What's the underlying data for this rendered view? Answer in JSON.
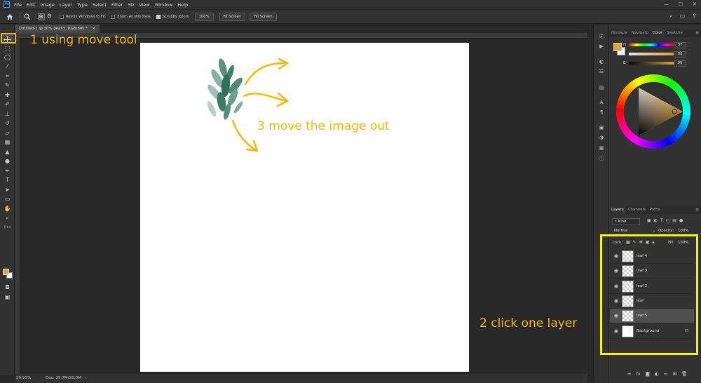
{
  "app": {
    "logo": "Ps"
  },
  "menubar": {
    "items": [
      "File",
      "Edit",
      "Image",
      "Layer",
      "Type",
      "Select",
      "Filter",
      "3D",
      "View",
      "Window",
      "Help"
    ],
    "window_controls": [
      "—",
      "☐",
      "✕"
    ]
  },
  "options": {
    "resize_windows": "Resize Windows to Fit",
    "zoom_all": "Zoom All Windows",
    "scrubby_zoom": "Scrubby Zoom",
    "zoom_pct": "100%",
    "fit_screen": "Fit Screen",
    "fill_screen": "Fill Screen"
  },
  "document": {
    "tab_title": "Untitled-1 @ 30% (leaf 5, RGB/8#) *"
  },
  "status": {
    "zoom": "29.97%",
    "doc": "Doc: 25.7M/20.0M"
  },
  "color_panel": {
    "tabs": [
      "Histogra",
      "Navigato",
      "Color",
      "Swatche"
    ],
    "active_tab": "Color",
    "h_label": "H",
    "h_value": "37",
    "s_label": "S",
    "s_value": "80",
    "b_label": "B",
    "b_value": "90",
    "foreground": "#e6a233",
    "background": "#ffffff"
  },
  "layers_panel": {
    "tabs": [
      "Layers",
      "Channels",
      "Paths"
    ],
    "active_tab": "Layers",
    "kind": "Kind",
    "blend_mode": "Normal",
    "opacity_label": "Opacity:",
    "opacity_value": "100%",
    "lock_label": "Lock:",
    "fill_label": "Fill:",
    "fill_value": "100%",
    "layers": [
      {
        "name": "leaf 4",
        "selected": false
      },
      {
        "name": "leaf 3",
        "selected": false
      },
      {
        "name": "leaf 2",
        "selected": false
      },
      {
        "name": "leaf",
        "selected": false
      },
      {
        "name": "leaf 5",
        "selected": true
      },
      {
        "name": "Background",
        "selected": false
      }
    ]
  },
  "annotations": {
    "step1": "1 using move tool",
    "step2": "2 click one layer",
    "step3": "3 move the image out",
    "color": "#f5b800"
  },
  "icons": {
    "home": "home-icon",
    "zoom": "zoom-icon",
    "move_tool": "move-icon"
  }
}
